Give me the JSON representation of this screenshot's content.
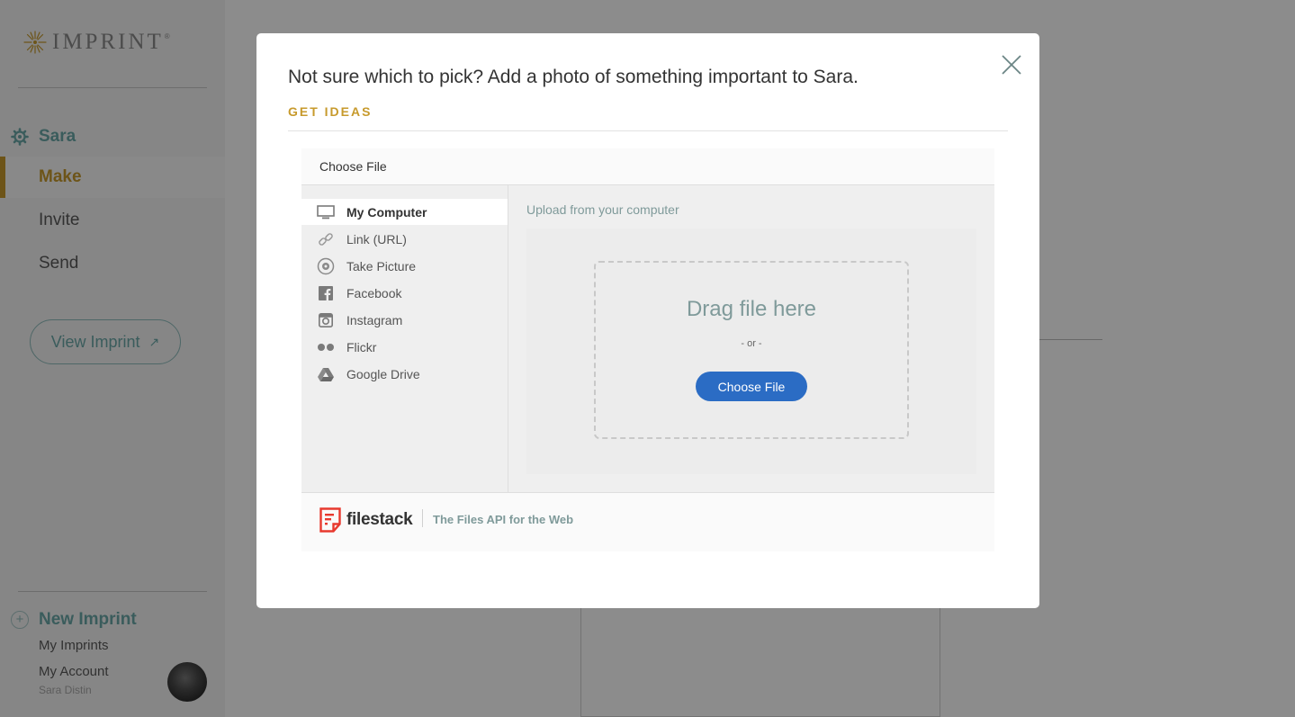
{
  "sidebar": {
    "logo_text": "IMPRINT",
    "logo_mark": "®",
    "owner": "Sara",
    "nav": [
      {
        "label": "Make",
        "active": true
      },
      {
        "label": "Invite",
        "active": false
      },
      {
        "label": "Send",
        "active": false
      }
    ],
    "view_button": "View Imprint",
    "view_arrow": "↗",
    "new_imprint": "New Imprint",
    "new_imprint_icon": "+",
    "my_imprints": "My Imprints",
    "my_account": "My Account",
    "user_name": "Sara Distin"
  },
  "modal": {
    "title": "Not sure which to pick? Add a photo of something important to Sara.",
    "get_ideas": "GET IDEAS",
    "picker": {
      "header": "Choose File",
      "sources": [
        {
          "label": "My Computer",
          "icon": "computer-icon",
          "active": true
        },
        {
          "label": "Link (URL)",
          "icon": "link-icon",
          "active": false
        },
        {
          "label": "Take Picture",
          "icon": "camera-icon",
          "active": false
        },
        {
          "label": "Facebook",
          "icon": "facebook-icon",
          "active": false
        },
        {
          "label": "Instagram",
          "icon": "instagram-icon",
          "active": false
        },
        {
          "label": "Flickr",
          "icon": "flickr-icon",
          "active": false
        },
        {
          "label": "Google Drive",
          "icon": "google-drive-icon",
          "active": false
        }
      ],
      "upload_heading": "Upload from your computer",
      "drag_text": "Drag file here",
      "or_text": "- or -",
      "choose_button": "Choose File",
      "brand": "filestack",
      "tagline": "The Files API for the Web"
    }
  },
  "colors": {
    "accent_gold": "#c79a2c",
    "accent_teal": "#6ba8a8",
    "button_blue": "#2b6cc4",
    "filestack_red": "#e8392e"
  }
}
